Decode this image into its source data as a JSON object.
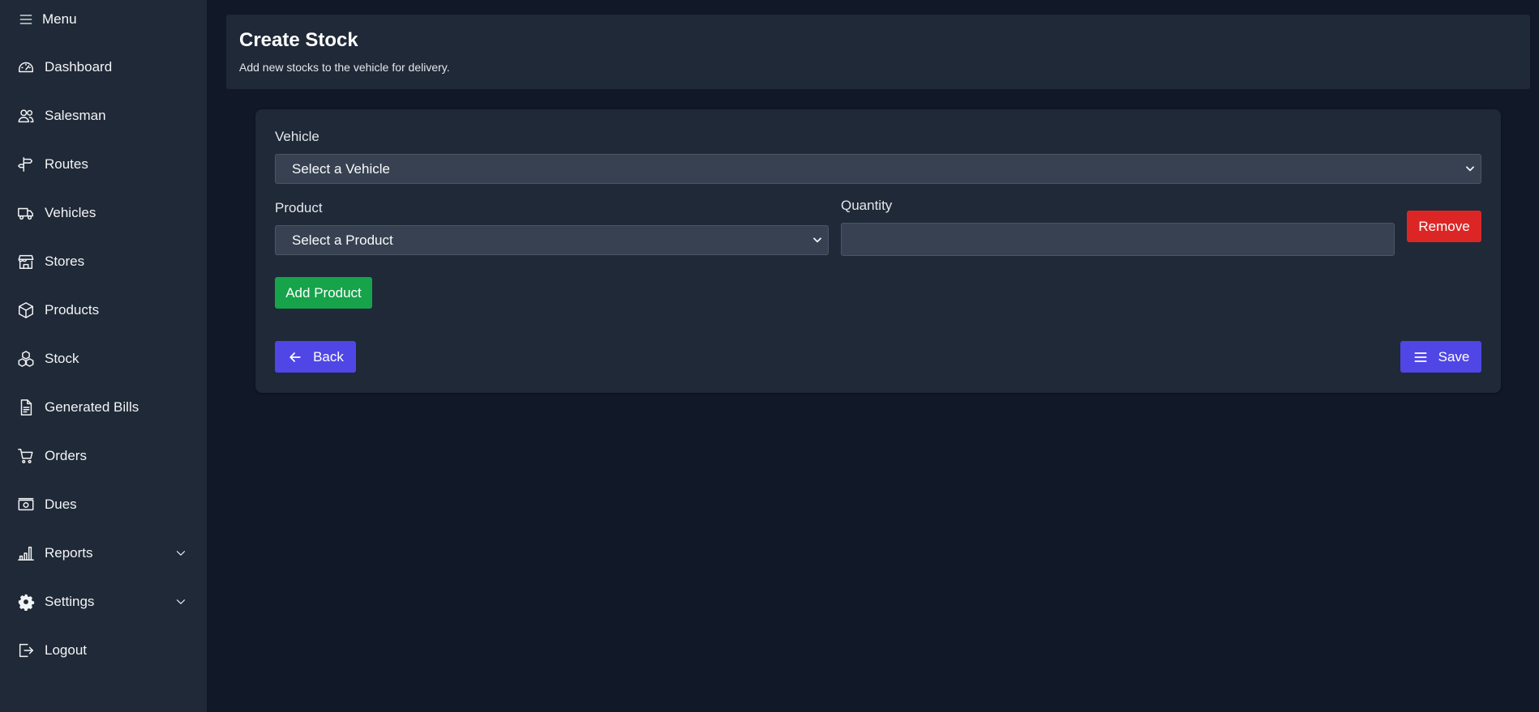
{
  "sidebar": {
    "menu_label": "Menu",
    "items": [
      {
        "label": "Dashboard",
        "icon": "dashboard-gauge-icon"
      },
      {
        "label": "Salesman",
        "icon": "users-icon"
      },
      {
        "label": "Routes",
        "icon": "signpost-icon"
      },
      {
        "label": "Vehicles",
        "icon": "truck-icon"
      },
      {
        "label": "Stores",
        "icon": "storefront-icon"
      },
      {
        "label": "Products",
        "icon": "cube-icon"
      },
      {
        "label": "Stock",
        "icon": "stacked-cubes-icon"
      },
      {
        "label": "Generated Bills",
        "icon": "document-icon"
      },
      {
        "label": "Orders",
        "icon": "cart-icon"
      },
      {
        "label": "Dues",
        "icon": "banknote-icon"
      },
      {
        "label": "Reports",
        "icon": "bar-chart-icon",
        "expandable": true
      },
      {
        "label": "Settings",
        "icon": "gear-icon",
        "expandable": true
      },
      {
        "label": "Logout",
        "icon": "logout-icon"
      }
    ]
  },
  "header": {
    "title": "Create Stock",
    "subtitle": "Add new stocks to the vehicle for delivery."
  },
  "form": {
    "vehicle_label": "Vehicle",
    "vehicle_select_value": "Select a Vehicle",
    "product_label": "Product",
    "product_select_value": "Select a Product",
    "quantity_label": "Quantity",
    "quantity_value": "",
    "remove_label": "Remove",
    "add_product_label": "Add Product",
    "back_label": "Back",
    "save_label": "Save"
  },
  "colors": {
    "background": "#111827",
    "panel": "#1f2937",
    "input": "#374151",
    "danger": "#dc2626",
    "success": "#16a34a",
    "primary": "#4f46e5"
  }
}
